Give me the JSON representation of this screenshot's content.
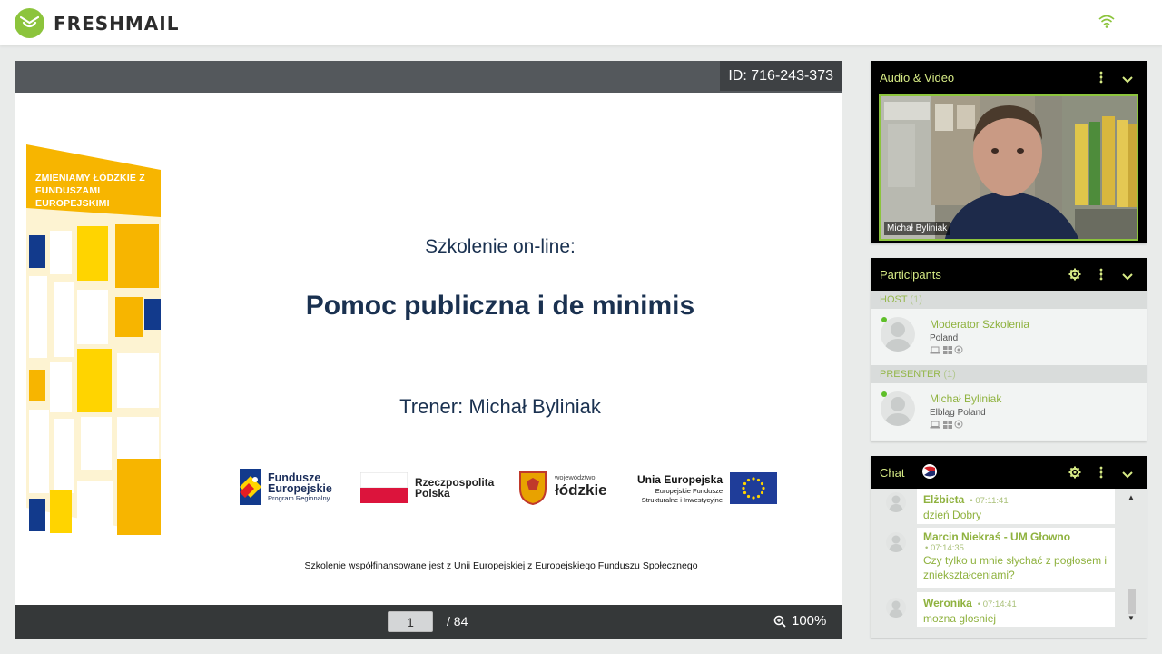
{
  "app": {
    "brand": "FRESHMAIL",
    "brand_color": "#8cc43c",
    "signal_icon": "wifi-icon"
  },
  "presentation": {
    "meeting_id": "ID: 716-243-373",
    "slide": {
      "decor_text": "ZMIENIAMY ŁÓDZKIE Z FUNDUSZAMI EUROPEJSKIMI",
      "subtitle": "Szkolenie on-line:",
      "title": "Pomoc publiczna i de minimis",
      "trainer": "Trener: Michał Byliniak",
      "logos": {
        "fe_title": "Fundusze Europejskie",
        "fe_sub": "Program Regionalny",
        "rp": "Rzeczpospolita Polska",
        "lodz_small": "województwo",
        "lodz_big": "łódzkie",
        "eu_title": "Unia Europejska",
        "eu_sub_1": "Europejskie Fundusze",
        "eu_sub_2": "Strukturalne i Inwestycyjne"
      },
      "footer": "Szkolenie współfinansowane jest z Unii Europejskiej z Europejskiego Funduszu Społecznego"
    },
    "page_current": "1",
    "page_total": "/ 84",
    "zoom": "100%"
  },
  "audio_video": {
    "title": "Audio & Video",
    "speaker": "Michał Byliniak",
    "icons": [
      "more-vert-icon",
      "chevron-down-icon"
    ]
  },
  "participants": {
    "title": "Participants",
    "icons": [
      "gear-icon",
      "more-vert-icon",
      "chevron-down-icon"
    ],
    "groups": [
      {
        "label": "HOST",
        "count": "(1)",
        "member": {
          "name": "Moderator Szkolenia",
          "location": "Poland"
        }
      },
      {
        "label": "PRESENTER",
        "count": "(1)",
        "member": {
          "name": "Michał Byliniak",
          "location": "Elbląg Poland"
        }
      }
    ],
    "device_icons": [
      "laptop-icon",
      "windows-icon",
      "browser-icon"
    ]
  },
  "chat": {
    "title": "Chat",
    "icons": [
      "flag-icon",
      "gear-icon",
      "more-vert-icon",
      "chevron-down-icon"
    ],
    "messages": [
      {
        "author": "Elżbieta",
        "time": "• 07:11:41",
        "text": "dzień Dobry"
      },
      {
        "author": "Marcin Niekraś - UM Głowno",
        "time": "• 07:14:35",
        "text": "Czy tylko u mnie słychać z pogłosem i zniekształceniami?"
      },
      {
        "author": "Weronika",
        "time": "• 07:14:41",
        "text": "mozna glosniej"
      }
    ]
  }
}
